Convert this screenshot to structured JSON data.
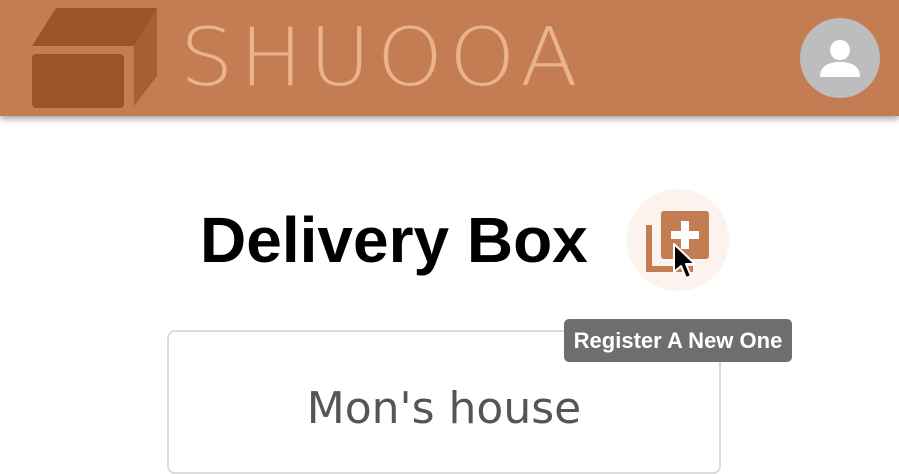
{
  "header": {
    "brand_name": "SHUOOA",
    "logo_icon": "box-icon",
    "avatar_icon": "person-icon"
  },
  "main": {
    "title": "Delivery Box",
    "add_icon": "add-to-collection-icon",
    "tooltip": "Register A New One",
    "boxes": [
      {
        "name": "Mon's house"
      }
    ]
  },
  "colors": {
    "header_bg": "#c47d53",
    "brand_text": "#eab488",
    "logo_dark": "#9c5427",
    "avatar_bg": "#bdbdbd",
    "tooltip_bg": "#6e6e6e"
  }
}
